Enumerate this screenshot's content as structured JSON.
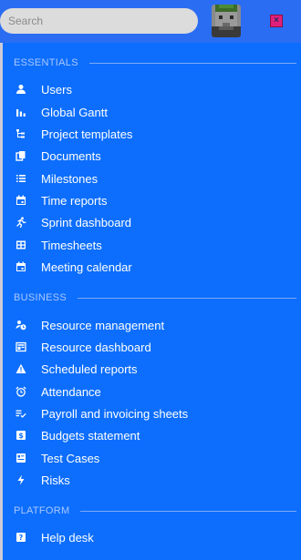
{
  "search": {
    "placeholder": "Search",
    "value": ""
  },
  "close_label": "×",
  "sections": [
    {
      "title": "ESSENTIALS",
      "items": [
        {
          "label": "Users",
          "icon": "person-icon"
        },
        {
          "label": "Global Gantt",
          "icon": "bar-chart-icon"
        },
        {
          "label": "Project templates",
          "icon": "tree-icon"
        },
        {
          "label": "Documents",
          "icon": "copy-icon"
        },
        {
          "label": "Milestones",
          "icon": "list-icon"
        },
        {
          "label": "Time reports",
          "icon": "calendar-icon"
        },
        {
          "label": "Sprint dashboard",
          "icon": "runner-icon"
        },
        {
          "label": "Timesheets",
          "icon": "grid-icon"
        },
        {
          "label": "Meeting calendar",
          "icon": "calendar-icon"
        }
      ]
    },
    {
      "title": "BUSINESS",
      "items": [
        {
          "label": "Resource management",
          "icon": "person-clock-icon"
        },
        {
          "label": "Resource dashboard",
          "icon": "dashboard-icon"
        },
        {
          "label": "Scheduled reports",
          "icon": "warning-icon"
        },
        {
          "label": "Attendance",
          "icon": "alarm-icon"
        },
        {
          "label": "Payroll and invoicing sheets",
          "icon": "list-check-icon"
        },
        {
          "label": "Budgets statement",
          "icon": "dollar-icon"
        },
        {
          "label": "Test Cases",
          "icon": "id-card-icon"
        },
        {
          "label": "Risks",
          "icon": "lightning-icon"
        }
      ]
    },
    {
      "title": "PLATFORM",
      "items": [
        {
          "label": "Help desk",
          "icon": "help-icon"
        }
      ]
    }
  ]
}
